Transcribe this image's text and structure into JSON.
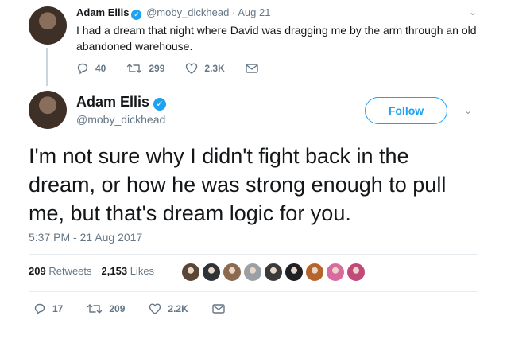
{
  "parent_tweet": {
    "author_name": "Adam Ellis",
    "handle": "@moby_dickhead",
    "separator": "·",
    "date": "Aug 21",
    "text": "I had a dream that night where David was dragging me by the arm through an old abandoned warehouse.",
    "replies": "40",
    "retweets": "299",
    "likes": "2.3K"
  },
  "main_tweet": {
    "author_name": "Adam Ellis",
    "handle": "@moby_dickhead",
    "follow_label": "Follow",
    "text": "I'm not sure why I didn't fight back in the dream, or how he was strong enough to pull me, but that's dream logic for you.",
    "timestamp": "5:37 PM - 21 Aug 2017",
    "retweet_count": "209",
    "retweets_label": "Retweets",
    "like_count": "2,153",
    "likes_label": "Likes",
    "liker_avatar_colors": [
      "#5b4636",
      "#2f3338",
      "#8c6a4f",
      "#9aa0a6",
      "#3a3a3a",
      "#1f2024",
      "#b5652b",
      "#d96aa0",
      "#c14a7a"
    ],
    "replies": "17",
    "retweets": "209",
    "likes": "2.2K"
  },
  "colors": {
    "accent": "#1da1f2",
    "muted_text": "#657786",
    "text": "#14171a",
    "verified": "#1da1f2"
  },
  "icons": [
    "verified-badge-icon",
    "chevron-down-icon",
    "reply-icon",
    "retweet-icon",
    "like-heart-icon",
    "direct-message-icon"
  ]
}
